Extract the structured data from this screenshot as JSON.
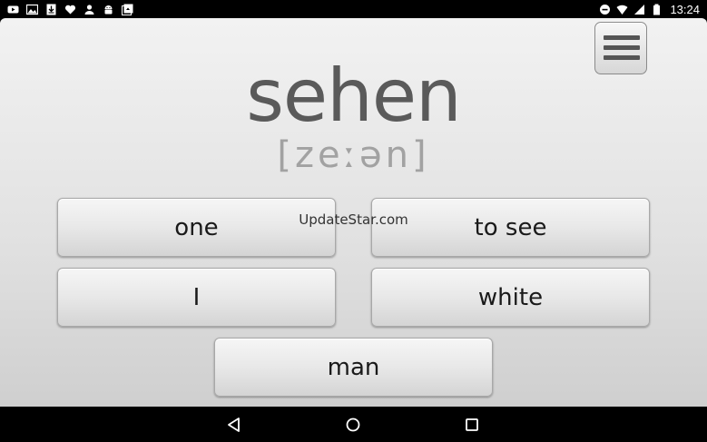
{
  "status_bar": {
    "time": "13:24",
    "left_icons": [
      "youtube-icon",
      "image-icon",
      "download-icon",
      "heart-icon",
      "person-icon",
      "android-icon",
      "photo-icon"
    ],
    "right_icons": [
      "do-not-disturb-icon",
      "wifi-icon",
      "signal-icon",
      "battery-icon"
    ]
  },
  "header": {
    "word": "sehen",
    "pronunciation": "[zeːən]"
  },
  "answers": [
    {
      "label": "one"
    },
    {
      "label": "to see"
    },
    {
      "label": "I"
    },
    {
      "label": "white"
    },
    {
      "label": "man"
    }
  ],
  "watermark": "UpdateStar.com",
  "colors": {
    "word": "#5a5a5a",
    "pronunciation": "#a2a2a2",
    "background_top": "#f2f2f2",
    "background_bottom": "#cfcfcf",
    "bars": "#000000"
  }
}
